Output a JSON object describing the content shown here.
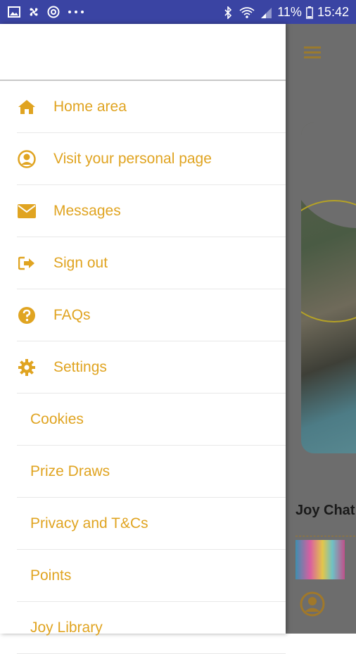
{
  "status_bar": {
    "left_icons": [
      "image-icon",
      "pinwheel-icon",
      "target-icon",
      "more-icon"
    ],
    "battery": "11%",
    "time": "15:42"
  },
  "drawer": {
    "items": [
      {
        "label": "Home area",
        "icon": "home-icon"
      },
      {
        "label": "Visit your personal page",
        "icon": "user-circle-icon"
      },
      {
        "label": "Messages",
        "icon": "envelope-icon"
      },
      {
        "label": "Sign out",
        "icon": "sign-out-icon"
      },
      {
        "label": "FAQs",
        "icon": "question-circle-icon"
      },
      {
        "label": "Settings",
        "icon": "gear-icon"
      },
      {
        "label": "Cookies"
      },
      {
        "label": "Prize Draws"
      },
      {
        "label": "Privacy and T&Cs"
      },
      {
        "label": "Points"
      },
      {
        "label": "Joy Library"
      }
    ]
  },
  "background": {
    "section_title": "Joy Chat"
  },
  "colors": {
    "accent": "#e0a421",
    "status_bar": "#3a44a3",
    "scrim": "#6d6d6d"
  }
}
